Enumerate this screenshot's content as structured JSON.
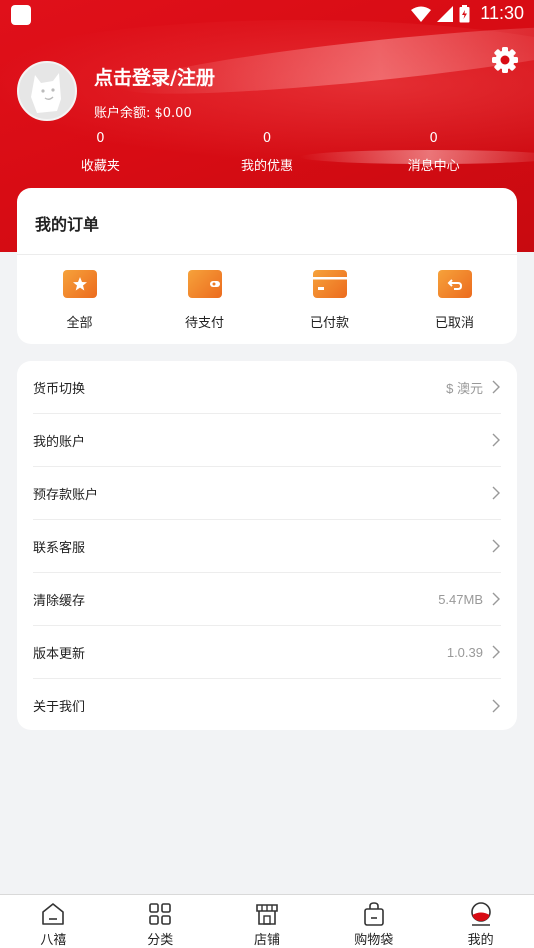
{
  "status_bar": {
    "time": "11:30"
  },
  "profile": {
    "login_text": "点击登录/注册",
    "balance_text": "账户余额: $0.00"
  },
  "stats": [
    {
      "count": "0",
      "label": "收藏夹"
    },
    {
      "count": "0",
      "label": "我的优惠"
    },
    {
      "count": "0",
      "label": "消息中心"
    }
  ],
  "orders": {
    "title": "我的订单",
    "items": [
      {
        "label": "全部",
        "icon": "star-icon"
      },
      {
        "label": "待支付",
        "icon": "wallet-icon"
      },
      {
        "label": "已付款",
        "icon": "card-icon"
      },
      {
        "label": "已取消",
        "icon": "undo-icon"
      }
    ]
  },
  "menu": [
    {
      "label": "货币切换",
      "value": "$ 澳元"
    },
    {
      "label": "我的账户",
      "value": ""
    },
    {
      "label": "预存款账户",
      "value": ""
    },
    {
      "label": "联系客服",
      "value": ""
    },
    {
      "label": "清除缓存",
      "value": "5.47MB"
    },
    {
      "label": "版本更新",
      "value": "1.0.39"
    },
    {
      "label": "关于我们",
      "value": ""
    }
  ],
  "tabs": [
    {
      "label": "八禧",
      "icon": "home-icon"
    },
    {
      "label": "分类",
      "icon": "grid-icon"
    },
    {
      "label": "店铺",
      "icon": "store-icon"
    },
    {
      "label": "购物袋",
      "icon": "bag-icon"
    },
    {
      "label": "我的",
      "icon": "profile-icon"
    }
  ],
  "colors": {
    "brand_red": "#d80c14",
    "order_icon_orange": "#ee7a24",
    "background": "#f2f3f5"
  }
}
